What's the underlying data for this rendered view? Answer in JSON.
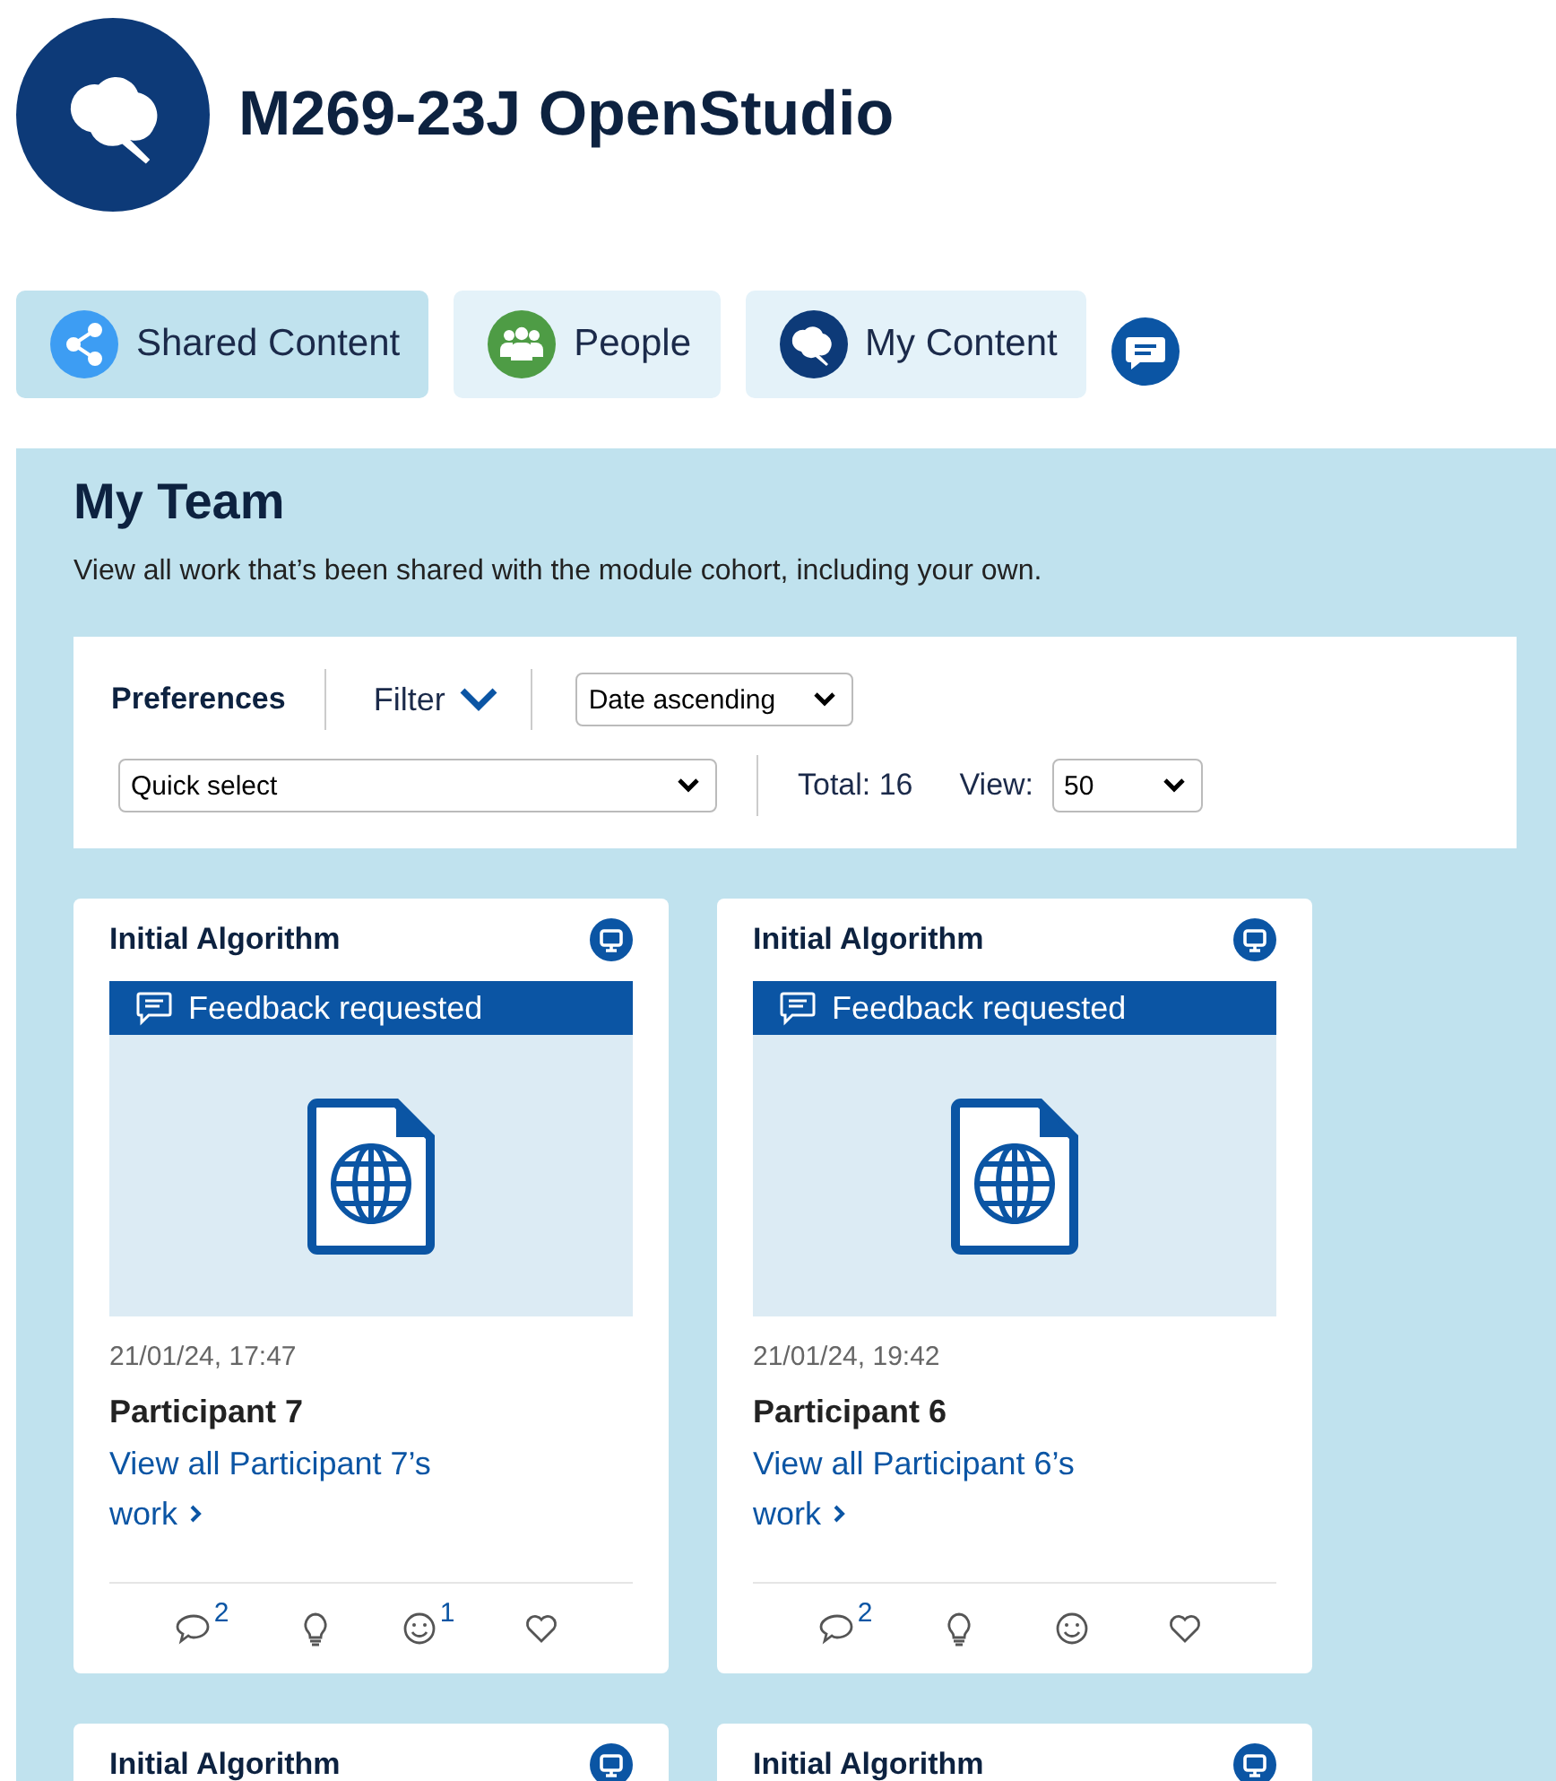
{
  "header": {
    "title": "M269-23J OpenStudio"
  },
  "tabs": [
    {
      "label": "Shared Content",
      "kind": "share",
      "selected": true
    },
    {
      "label": "People",
      "kind": "people",
      "selected": false
    },
    {
      "label": "My Content",
      "kind": "pin",
      "selected": false
    }
  ],
  "section": {
    "title": "My Team",
    "description": "View all work that’s been shared with the module cohort, including your own."
  },
  "preferences": {
    "label": "Preferences",
    "filter": "Filter",
    "sort": "Date ascending",
    "quick_select": "Quick select",
    "total": "Total: 16",
    "view_label": "View:",
    "view": "50"
  },
  "cards": [
    {
      "title": "Initial Algorithm",
      "banner": "Feedback requested",
      "date": "21/01/24, 17:47",
      "author": "Participant 7",
      "link": "View all Participant 7’s work",
      "reactions": [
        {
          "kind": "comment",
          "count": "2"
        },
        {
          "kind": "idea"
        },
        {
          "kind": "smile",
          "count": "1"
        },
        {
          "kind": "heart"
        }
      ]
    },
    {
      "title": "Initial Algorithm",
      "banner": "Feedback requested",
      "date": "21/01/24, 19:42",
      "author": "Participant 6",
      "link": "View all Participant 6’s work",
      "reactions": [
        {
          "kind": "comment",
          "count": "2"
        },
        {
          "kind": "idea"
        },
        {
          "kind": "smile"
        },
        {
          "kind": "heart"
        }
      ]
    },
    {
      "title": "Initial Algorithm"
    },
    {
      "title": "Initial Algorithm"
    }
  ]
}
